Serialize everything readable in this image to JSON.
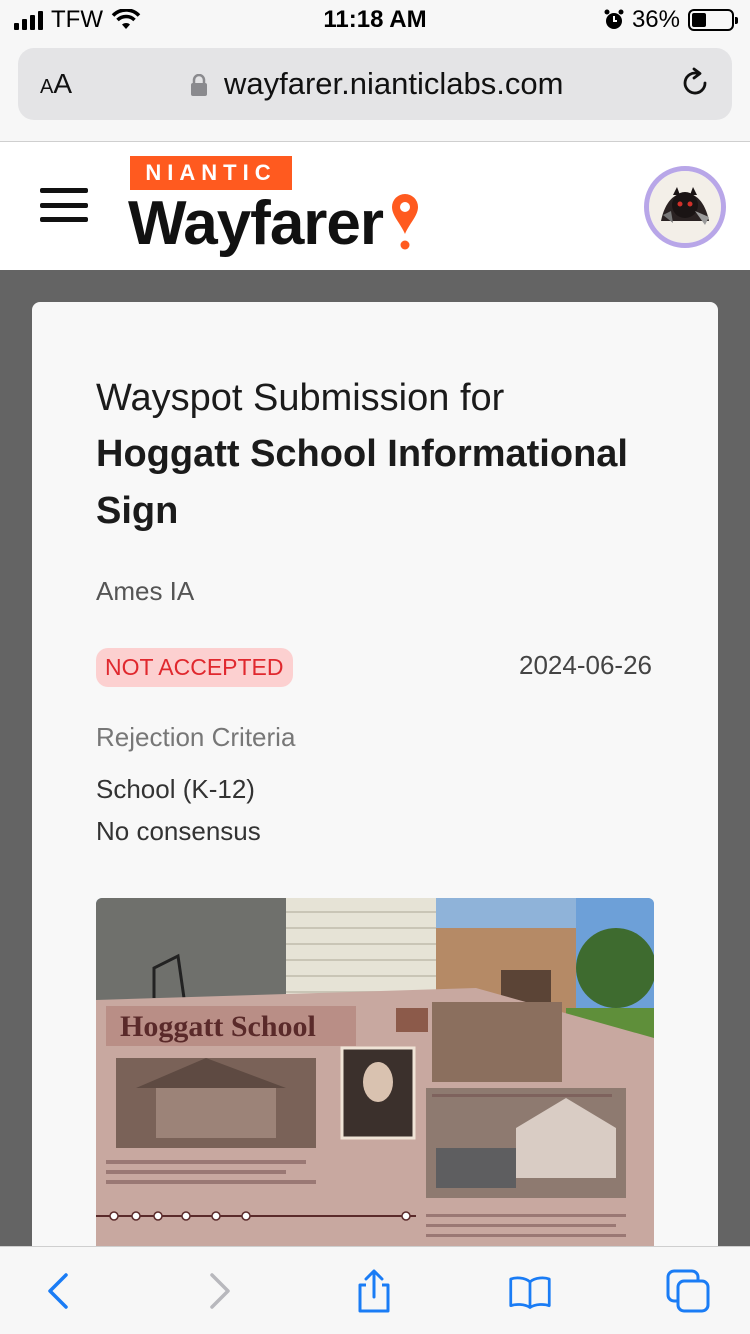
{
  "status_bar": {
    "carrier": "TFW",
    "time": "11:18 AM",
    "battery": "36%"
  },
  "browser": {
    "text_size_small": "A",
    "text_size_large": "A",
    "url": "wayfarer.nianticlabs.com"
  },
  "header": {
    "brand_badge": "NIANTIC",
    "brand_name": "Wayfarer"
  },
  "submission": {
    "heading_prefix": "Wayspot Submission for",
    "title": "Hoggatt School Informational Sign",
    "location": "Ames IA",
    "status": "NOT ACCEPTED",
    "date": "2024-06-26",
    "rejection_label": "Rejection Criteria",
    "rejection_reasons": [
      "School (K-12)",
      "No consensus"
    ],
    "photo_sign_title": "Hoggatt School"
  },
  "colors": {
    "brand_orange": "#ff5a1f",
    "status_red": "#e0282e",
    "status_bg": "#fcd0d0",
    "ios_blue": "#1a7cf5"
  },
  "icons": [
    "hamburger-menu-icon",
    "location-pin-icon",
    "lock-icon",
    "reload-icon",
    "back-icon",
    "forward-icon",
    "share-icon",
    "bookmarks-icon",
    "tabs-icon",
    "alarm-icon",
    "wifi-icon"
  ]
}
